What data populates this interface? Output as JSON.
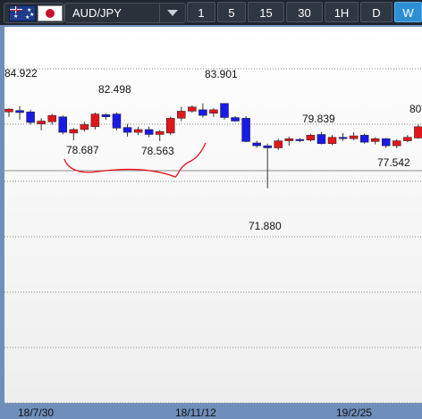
{
  "toolbar": {
    "pair_label": "AUD/JPY",
    "timeframes": [
      "1",
      "5",
      "15",
      "30",
      "1H",
      "D",
      "W"
    ],
    "active_timeframe": "W"
  },
  "chart_data": {
    "type": "candlestick",
    "symbol": "AUD/JPY",
    "timeframe": "W",
    "x_tick_labels": [
      "18/7/30",
      "18/11/12",
      "19/2/25"
    ],
    "annotations": [
      "84.922",
      "82.498",
      "78.687",
      "78.563",
      "83.901",
      "71.880",
      "79.839",
      "77.542",
      "80"
    ],
    "colors": {
      "up": "#e0161b",
      "down": "#1a1ae6",
      "drawing": "#e8101b"
    },
    "candles": [
      {
        "o": 82.7,
        "h": 83.2,
        "l": 82.0,
        "c": 83.1
      },
      {
        "o": 82.9,
        "h": 83.5,
        "l": 81.6,
        "c": 82.6
      },
      {
        "o": 82.7,
        "h": 83.0,
        "l": 80.9,
        "c": 81.2
      },
      {
        "o": 81.0,
        "h": 81.8,
        "l": 80.1,
        "c": 81.4
      },
      {
        "o": 81.3,
        "h": 82.4,
        "l": 80.9,
        "c": 82.2
      },
      {
        "o": 82.0,
        "h": 82.2,
        "l": 79.5,
        "c": 79.8
      },
      {
        "o": 79.7,
        "h": 80.4,
        "l": 78.687,
        "c": 80.2
      },
      {
        "o": 80.2,
        "h": 81.3,
        "l": 79.9,
        "c": 80.9
      },
      {
        "o": 80.6,
        "h": 82.6,
        "l": 80.2,
        "c": 82.4
      },
      {
        "o": 82.3,
        "h": 82.498,
        "l": 81.6,
        "c": 82.0
      },
      {
        "o": 82.4,
        "h": 82.6,
        "l": 80.1,
        "c": 80.4
      },
      {
        "o": 80.5,
        "h": 81.0,
        "l": 79.2,
        "c": 79.8
      },
      {
        "o": 79.8,
        "h": 80.6,
        "l": 79.4,
        "c": 80.2
      },
      {
        "o": 80.2,
        "h": 80.6,
        "l": 79.1,
        "c": 79.5
      },
      {
        "o": 79.5,
        "h": 80.1,
        "l": 78.563,
        "c": 79.9
      },
      {
        "o": 79.7,
        "h": 82.0,
        "l": 79.4,
        "c": 81.8
      },
      {
        "o": 81.8,
        "h": 83.4,
        "l": 81.4,
        "c": 82.8
      },
      {
        "o": 82.8,
        "h": 83.6,
        "l": 82.6,
        "c": 83.4
      },
      {
        "o": 83.0,
        "h": 83.9,
        "l": 81.9,
        "c": 82.2
      },
      {
        "o": 82.5,
        "h": 83.2,
        "l": 82.0,
        "c": 83.0
      },
      {
        "o": 83.9,
        "h": 83.901,
        "l": 81.6,
        "c": 81.9
      },
      {
        "o": 81.9,
        "h": 82.1,
        "l": 81.3,
        "c": 81.4
      },
      {
        "o": 81.8,
        "h": 82.1,
        "l": 78.4,
        "c": 78.5
      },
      {
        "o": 78.3,
        "h": 78.6,
        "l": 77.6,
        "c": 77.9
      },
      {
        "o": 77.9,
        "h": 78.2,
        "l": 71.88,
        "c": 77.6
      },
      {
        "o": 77.6,
        "h": 78.9,
        "l": 77.3,
        "c": 78.6
      },
      {
        "o": 78.6,
        "h": 79.2,
        "l": 77.9,
        "c": 78.9
      },
      {
        "o": 78.8,
        "h": 79.0,
        "l": 78.4,
        "c": 78.7
      },
      {
        "o": 78.7,
        "h": 79.6,
        "l": 78.5,
        "c": 79.4
      },
      {
        "o": 79.5,
        "h": 79.839,
        "l": 78.1,
        "c": 78.2
      },
      {
        "o": 78.2,
        "h": 79.4,
        "l": 78.0,
        "c": 79.1
      },
      {
        "o": 79.1,
        "h": 79.7,
        "l": 78.6,
        "c": 78.9
      },
      {
        "o": 78.9,
        "h": 79.8,
        "l": 78.7,
        "c": 79.3
      },
      {
        "o": 79.4,
        "h": 79.6,
        "l": 78.2,
        "c": 78.4
      },
      {
        "o": 78.5,
        "h": 79.1,
        "l": 78.1,
        "c": 78.9
      },
      {
        "o": 78.9,
        "h": 79.0,
        "l": 77.6,
        "c": 77.9
      },
      {
        "o": 77.9,
        "h": 78.8,
        "l": 77.542,
        "c": 78.6
      },
      {
        "o": 78.6,
        "h": 79.4,
        "l": 78.4,
        "c": 79.1
      },
      {
        "o": 79.0,
        "h": 80.9,
        "l": 78.9,
        "c": 80.6
      },
      {
        "o": 80.7,
        "h": 81.3,
        "l": 80.1,
        "c": 80.5
      }
    ],
    "horizontal_line": 76.3,
    "y_gridlines": [
      84.5,
      80.0,
      75.5,
      71.0,
      66.5,
      62.0,
      57.5,
      53.0
    ],
    "ylim": [
      52.5,
      87.0
    ]
  }
}
